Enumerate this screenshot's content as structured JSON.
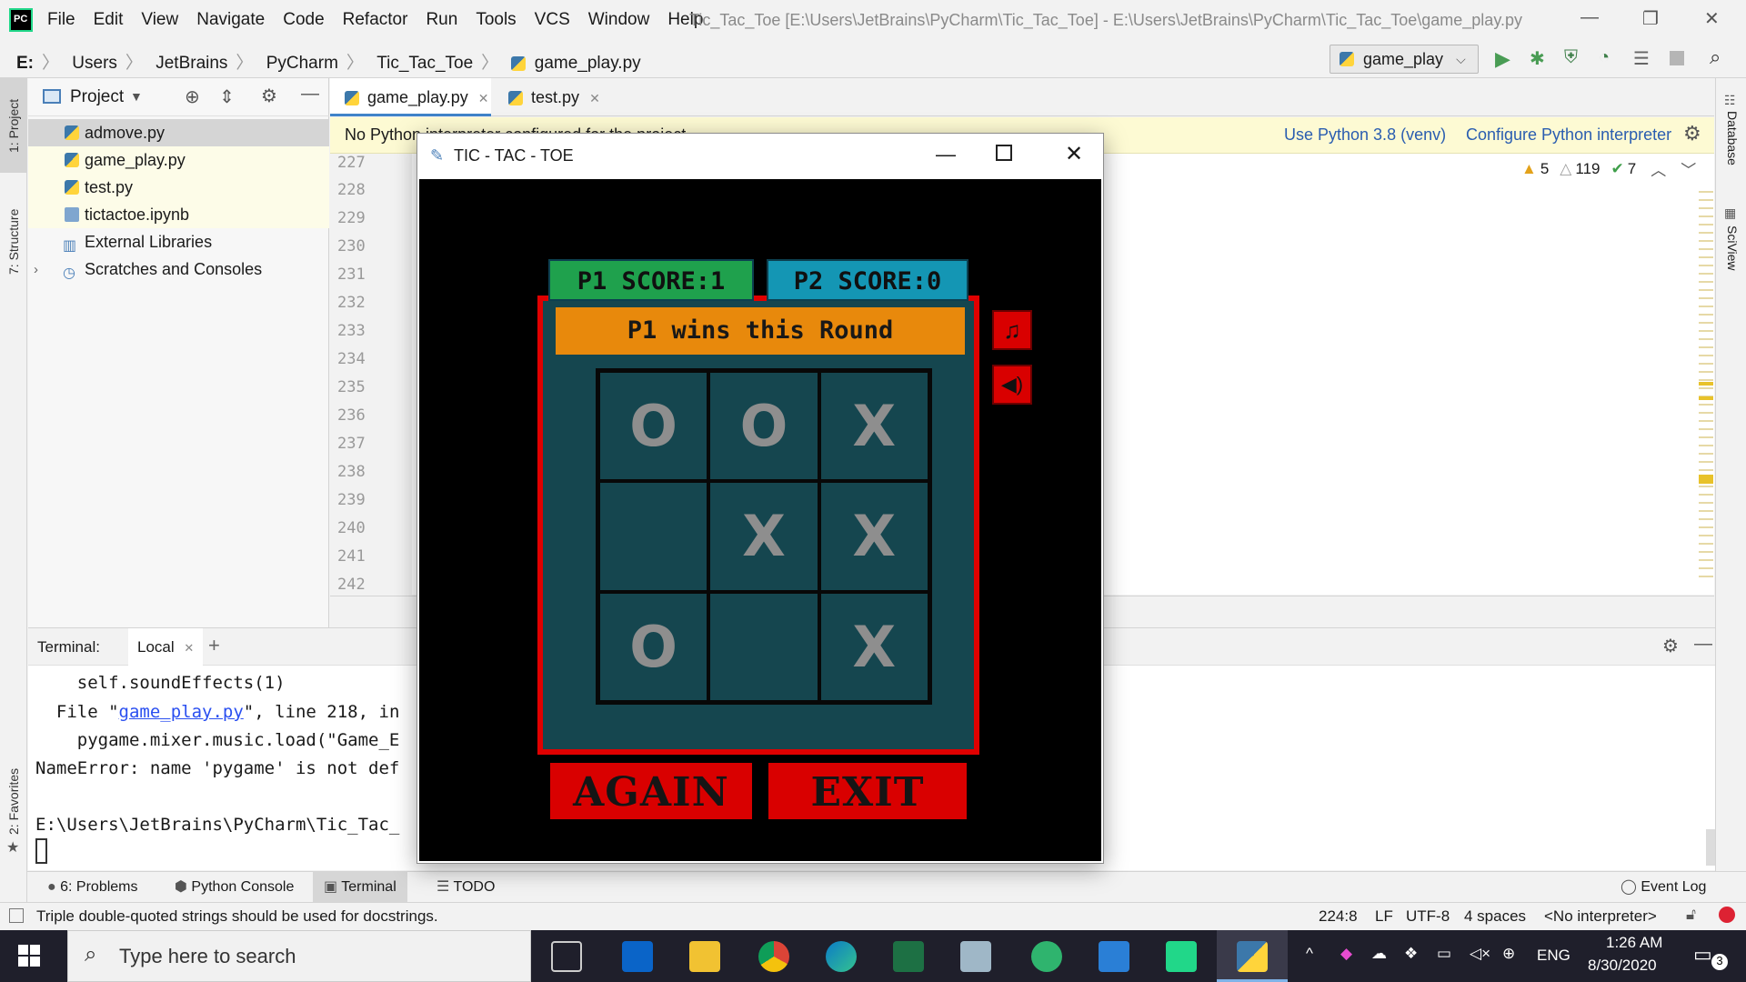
{
  "ide": {
    "menu": [
      "File",
      "Edit",
      "View",
      "Navigate",
      "Code",
      "Refactor",
      "Run",
      "Tools",
      "VCS",
      "Window",
      "Help"
    ],
    "window_title": "Tic_Tac_Toe [E:\\Users\\JetBrains\\PyCharm\\Tic_Tac_Toe] - E:\\Users\\JetBrains\\PyCharm\\Tic_Tac_Toe\\game_play.py",
    "breadcrumbs": [
      "E:",
      "Users",
      "JetBrains",
      "PyCharm",
      "Tic_Tac_Toe",
      "game_play.py"
    ],
    "run_config": "game_play"
  },
  "project": {
    "title": "Project",
    "items": [
      {
        "label": "admove.py"
      },
      {
        "label": "game_play.py"
      },
      {
        "label": "test.py"
      },
      {
        "label": "tictactoe.ipynb"
      },
      {
        "label": "External Libraries"
      },
      {
        "label": "Scratches and Consoles"
      }
    ]
  },
  "editor": {
    "tabs": [
      "game_play.py",
      "test.py"
    ],
    "warning": "No Python interpreter configured for the project",
    "use_interpreter": "Use Python 3.8 (venv)",
    "configure_interpreter": "Configure Python interpreter",
    "inspections": {
      "warnings": "5",
      "weak": "119",
      "ok": "7"
    },
    "line_numbers": [
      "227",
      "228",
      "229",
      "230",
      "231",
      "232",
      "233",
      "234",
      "235",
      "236",
      "237",
      "238",
      "239",
      "240",
      "241",
      "242"
    ]
  },
  "side_labels": {
    "project": "1: Project",
    "structure": "7: Structure",
    "favorites": "2: Favorites",
    "database": "Database",
    "sciview": "SciView"
  },
  "terminal": {
    "label": "Terminal:",
    "tab": "Local",
    "lines": [
      {
        "pre": "    self.soundEffects(1)",
        "link": "",
        "post": ""
      },
      {
        "pre": "  File \"",
        "link": "game_play.py",
        "post": "\", line 218, in"
      },
      {
        "pre": "    pygame.mixer.music.load(\"Game_E",
        "link": "",
        "post": ""
      },
      {
        "pre": "NameError: name 'pygame' is not def",
        "link": "",
        "post": ""
      },
      {
        "pre": "",
        "link": "",
        "post": ""
      },
      {
        "pre": "E:\\Users\\JetBrains\\PyCharm\\Tic_Tac_",
        "link": "",
        "post": ""
      }
    ]
  },
  "tool_tabs": [
    "6: Problems",
    "Python Console",
    "Terminal",
    "TODO"
  ],
  "event_log": "Event Log",
  "status": {
    "message": "Triple double-quoted strings should be used for docstrings.",
    "position": "224:8",
    "line_sep": "LF",
    "encoding": "UTF-8",
    "indent": "4 spaces",
    "interpreter": "<No interpreter>"
  },
  "taskbar": {
    "search_placeholder": "Type here to search",
    "lang": "ENG",
    "time": "1:26 AM",
    "date": "8/30/2020",
    "notifications": "3"
  },
  "game": {
    "title": "TIC - TAC - TOE",
    "p1_score": "P1  SCORE:1",
    "p2_score": "P2  SCORE:0",
    "banner": "P1 wins this Round",
    "board": [
      "O",
      "O",
      "X",
      "",
      "X",
      "X",
      "O",
      "",
      "X"
    ],
    "again": "AGAIN",
    "exit": "EXIT",
    "colors": {
      "board": "#15464f",
      "border": "#e00000",
      "p1": "#1fa14d",
      "p2": "#1496b4",
      "banner": "#e8890c"
    }
  }
}
